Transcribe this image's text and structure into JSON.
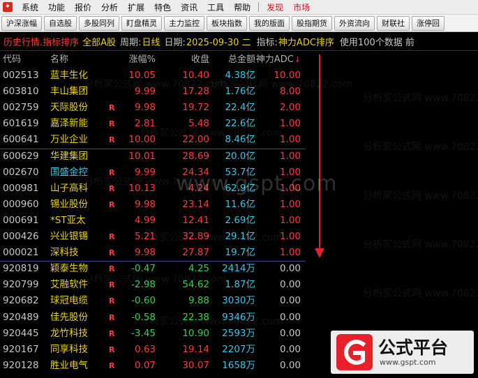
{
  "menubar": {
    "items": [
      "系统",
      "功能",
      "报价",
      "分析",
      "扩展",
      "特色",
      "资讯",
      "工具",
      "帮助"
    ],
    "highlight_items": [
      "发现",
      "市场"
    ]
  },
  "toolbar": {
    "buttons": [
      "沪深涨幅",
      "自选股",
      "多股同列",
      "盯盘精灵",
      "主力监控",
      "板块指数",
      "我的版面",
      "股指期货",
      "外资流向",
      "财联社",
      "涨停回"
    ]
  },
  "infobar": {
    "mode": "历史行情.指标排序",
    "market": "全部A股",
    "period_label": "周期:",
    "period_value": "日线",
    "date_label": "日期:",
    "date_value": "2025-09-30 二",
    "indicator_label": "指标:",
    "indicator_value": "神力ADC排序",
    "note": "使用100个数据 前"
  },
  "table": {
    "columns": {
      "code": "代码",
      "name": "名称",
      "pct": "涨幅%",
      "close": "收盘",
      "amount": "总金额",
      "adc": "神力ADC"
    },
    "rows": [
      {
        "code": "002513",
        "name": "蓝丰生化",
        "flag": "",
        "pct": "10.05",
        "close": "10.40",
        "amount": "4.38亿",
        "adc": "10.00"
      },
      {
        "code": "603810",
        "name": "丰山集团",
        "flag": "",
        "pct": "9.99",
        "close": "17.28",
        "amount": "1.76亿",
        "adc": "8.00"
      },
      {
        "code": "002759",
        "name": "天际股份",
        "flag": "R",
        "pct": "9.98",
        "close": "19.72",
        "amount": "22.4亿",
        "adc": "2.00"
      },
      {
        "code": "601619",
        "name": "嘉泽新能",
        "flag": "R",
        "pct": "2.81",
        "close": "5.48",
        "amount": "22.6亿",
        "adc": "1.00"
      },
      {
        "code": "600641",
        "name": "万业企业",
        "flag": "R",
        "pct": "10.00",
        "close": "22.00",
        "amount": "8.46亿",
        "adc": "1.00"
      },
      {
        "code": "600629",
        "name": "华建集团",
        "flag": "",
        "pct": "10.01",
        "close": "28.69",
        "amount": "20.0亿",
        "adc": "1.00"
      },
      {
        "code": "002670",
        "name": "国盛金控",
        "flag": "R",
        "pct": "9.99",
        "close": "24.34",
        "amount": "53.7亿",
        "adc": "1.00"
      },
      {
        "code": "000981",
        "name": "山子高科",
        "flag": "R",
        "pct": "10.13",
        "close": "4.24",
        "amount": "62.9亿",
        "adc": "1.00"
      },
      {
        "code": "000960",
        "name": "锡业股份",
        "flag": "R",
        "pct": "9.98",
        "close": "23.14",
        "amount": "11.6亿",
        "adc": "1.00"
      },
      {
        "code": "000691",
        "name": "*ST亚太",
        "flag": "",
        "pct": "4.99",
        "close": "12.41",
        "amount": "2.69亿",
        "adc": "1.00"
      },
      {
        "code": "000426",
        "name": "兴业银锡",
        "flag": "R",
        "pct": "5.21",
        "close": "32.89",
        "amount": "29.1亿",
        "adc": "1.00"
      },
      {
        "code": "000021",
        "name": "深科技",
        "flag": "R",
        "pct": "9.98",
        "close": "27.87",
        "amount": "19.7亿",
        "adc": "1.00"
      },
      {
        "code": "920819",
        "name": "颖泰生物",
        "flag": "R",
        "pct": "-0.47",
        "close": "4.25",
        "amount": "2414万",
        "adc": "0.00"
      },
      {
        "code": "920799",
        "name": "艾融软件",
        "flag": "R",
        "pct": "-2.98",
        "close": "54.62",
        "amount": "1.87亿",
        "adc": "0.00"
      },
      {
        "code": "920682",
        "name": "球冠电缆",
        "flag": "R",
        "pct": "-0.60",
        "close": "9.88",
        "amount": "3030万",
        "adc": "0.00"
      },
      {
        "code": "920489",
        "name": "佳先股份",
        "flag": "R",
        "pct": "-0.58",
        "close": "22.38",
        "amount": "9346万",
        "adc": "0.00"
      },
      {
        "code": "920445",
        "name": "龙竹科技",
        "flag": "R",
        "pct": "-3.45",
        "close": "10.90",
        "amount": "2593万",
        "adc": "0.00"
      },
      {
        "code": "920167",
        "name": "同享科技",
        "flag": "R",
        "pct": "0.63",
        "close": "19.14",
        "amount": "2207万",
        "adc": "0.00"
      },
      {
        "code": "920128",
        "name": "胜业电气",
        "flag": "R",
        "pct": "0.07",
        "close": "30.07",
        "amount": "1658万",
        "adc": "0.00"
      }
    ]
  },
  "colors": {
    "up": "#ff3b3b",
    "down": "#33d44a",
    "neutral": "#c8c8c8",
    "name_default": "#e8d21d",
    "name_highlight": "#39c8e8",
    "amount": "#39c8e8",
    "code": "#c8c8c8"
  },
  "highlighted_names": [
    "国盛金控"
  ],
  "watermark": {
    "big": "www.gspt.com",
    "small": "分析家公式网 www.70822.com"
  },
  "logo": {
    "name": "公式平台",
    "url": "www.gspt.com"
  }
}
